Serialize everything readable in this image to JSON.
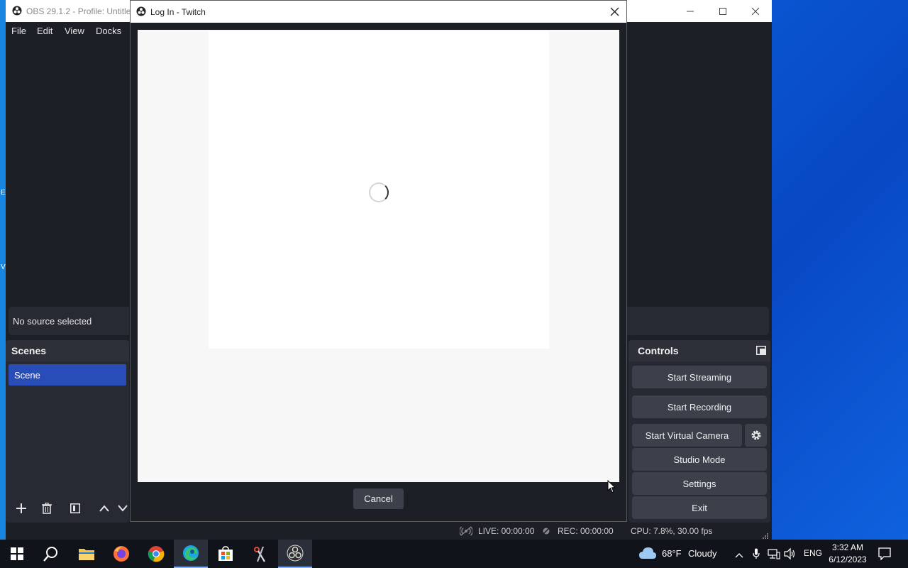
{
  "obs_window": {
    "title": "OBS 29.1.2 - Profile: Untitled",
    "menu": [
      "File",
      "Edit",
      "View",
      "Docks"
    ],
    "no_source_text": "No source selected",
    "scenes_dock": {
      "title": "Scenes",
      "items": [
        "Scene"
      ]
    },
    "controls_dock": {
      "title": "Controls",
      "buttons": {
        "start_streaming": "Start Streaming",
        "start_recording": "Start Recording",
        "start_virtual_camera": "Start Virtual Camera",
        "studio_mode": "Studio Mode",
        "settings": "Settings",
        "exit": "Exit"
      }
    },
    "status": {
      "live": "LIVE: 00:00:00",
      "rec": "REC: 00:00:00",
      "cpu": "CPU: 7.8%, 30.00 fps"
    }
  },
  "dialog": {
    "title": "Log In - Twitch",
    "cancel_label": "Cancel"
  },
  "taskbar": {
    "weather_temp": "68°F",
    "weather_desc": "Cloudy",
    "language": "ENG",
    "time": "3:32 AM",
    "date": "6/12/2023"
  },
  "desktop": {
    "left_edge_chars": [
      "E",
      "V"
    ]
  },
  "colors": {
    "accent": "#284cb8",
    "obs_bg": "#1d1f27",
    "dock_bg": "#272a33",
    "button_bg": "#3c404b",
    "desktop_blue": "#0a5ad6"
  }
}
